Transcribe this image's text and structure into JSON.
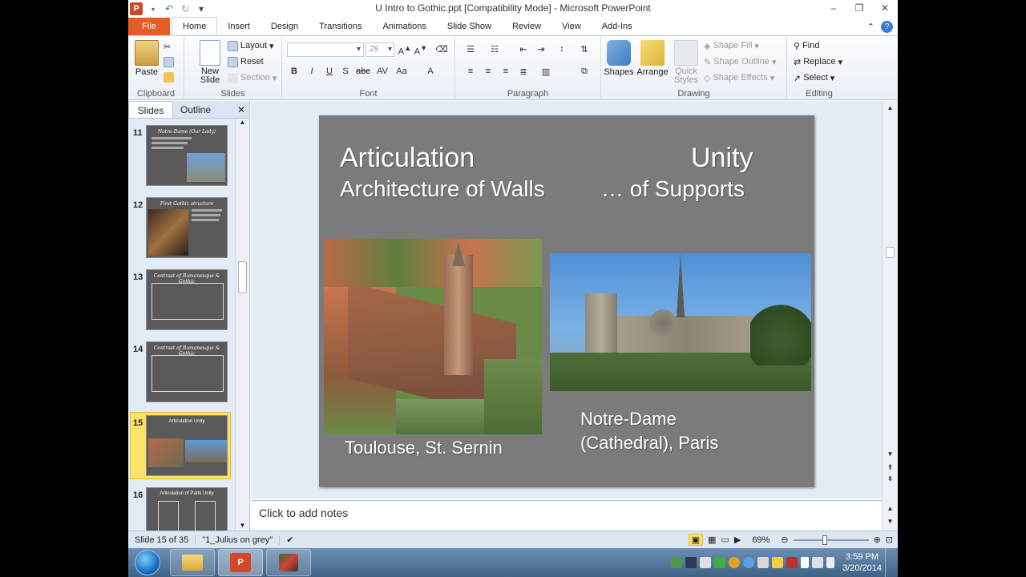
{
  "window": {
    "title": "U Intro to Gothic.ppt [Compatibility Mode]  -  Microsoft PowerPoint",
    "app_logo": "P"
  },
  "tabs": [
    "File",
    "Home",
    "Insert",
    "Design",
    "Transitions",
    "Animations",
    "Slide Show",
    "Review",
    "View",
    "Add-Ins"
  ],
  "active_tab": "Home",
  "ribbon": {
    "clipboard": {
      "label": "Clipboard",
      "paste": "Paste"
    },
    "slides": {
      "label": "Slides",
      "new_slide_1": "New",
      "new_slide_2": "Slide",
      "layout": "Layout",
      "reset": "Reset",
      "section": "Section"
    },
    "font": {
      "label": "Font",
      "font_size": "28"
    },
    "paragraph": {
      "label": "Paragraph"
    },
    "drawing": {
      "label": "Drawing",
      "shapes": "Shapes",
      "arrange": "Arrange",
      "quick_1": "Quick",
      "quick_2": "Styles",
      "shape_fill": "Shape Fill",
      "shape_outline": "Shape Outline",
      "shape_effects": "Shape Effects"
    },
    "editing": {
      "label": "Editing",
      "find": "Find",
      "replace": "Replace",
      "select": "Select"
    }
  },
  "left_pane": {
    "tab_slides": "Slides",
    "tab_outline": "Outline",
    "close": "✕",
    "thumbnails": [
      {
        "num": "11",
        "title": "Notre-Dame (Our Lady)"
      },
      {
        "num": "12",
        "title": "First Gothic structure"
      },
      {
        "num": "13",
        "title": "Contrast of Romanesque & Gothic"
      },
      {
        "num": "14",
        "title": "Contrast of Romanesque & Gothic"
      },
      {
        "num": "15",
        "title": "Articulation     Unity",
        "selected": true
      },
      {
        "num": "16",
        "title": "Articulation of Parts     Unity"
      }
    ]
  },
  "slide": {
    "heading_left": "Articulation",
    "heading_right": "Unity",
    "sub_left": "Architecture of Walls",
    "sub_right": "… of Supports",
    "caption_left": "Toulouse, St. Sernin",
    "caption_right_1": "Notre-Dame",
    "caption_right_2": "(Cathedral), Paris"
  },
  "notes_placeholder": "Click to add notes",
  "status": {
    "slide_info": "Slide 15 of 35",
    "theme": "\"1_Julius on grey\"",
    "zoom": "69%"
  },
  "taskbar": {
    "time": "3:59 PM",
    "date": "3/20/2014"
  },
  "colors": {
    "file_tab": "#e55d26",
    "slide_bg": "#7b7b7b",
    "selected_thumb": "#fbe26a"
  }
}
